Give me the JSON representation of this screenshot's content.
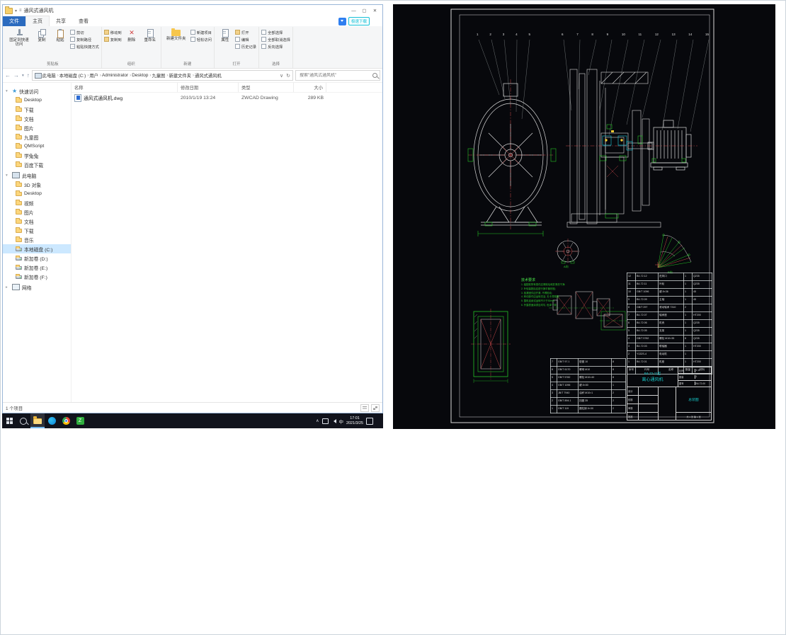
{
  "explorer": {
    "titlebar": {
      "title": "通风式通风机",
      "minimize": "—",
      "maximize": "▢",
      "close": "✕"
    },
    "tabs": {
      "file": "文件",
      "home": "主页",
      "share": "共享",
      "view": "查看"
    },
    "overlay": {
      "badge": "极速下载"
    },
    "ribbon": {
      "pin": "固定到快速访问",
      "copy": "复制",
      "paste": "粘贴",
      "cut": "剪切",
      "copy_path": "复制路径",
      "paste_shortcut": "粘贴快捷方式",
      "clipboard_label": "剪贴板",
      "move_to": "移动到",
      "copy_to": "复制到",
      "delete": "删除",
      "rename": "重命名",
      "organize_label": "组织",
      "new_folder": "新建文件夹",
      "new_item": "新建项目",
      "easy_access": "轻松访问",
      "new_label": "新建",
      "properties": "属性",
      "open": "打开",
      "edit": "编辑",
      "history": "历史记录",
      "open_label": "打开",
      "select_all": "全部选择",
      "select_none": "全部取消选择",
      "invert": "反向选择",
      "select_label": "选择"
    },
    "address": {
      "segments": [
        {
          "label": "此电脑"
        },
        {
          "label": "本地磁盘 (C:)"
        },
        {
          "label": "用户"
        },
        {
          "label": "Administrator"
        },
        {
          "label": "Desktop"
        },
        {
          "label": "九童图"
        },
        {
          "label": "新建文件夹"
        },
        {
          "label": "通风式通风机"
        }
      ],
      "search_placeholder": "搜索\"通风式通风机\""
    },
    "columns": {
      "name": "名称",
      "date": "修改日期",
      "type": "类型",
      "size": "大小"
    },
    "files": [
      {
        "name": "通风式通风机.dwg",
        "modified": "2010/1/19 13:24",
        "type": "ZWCAD Drawing",
        "size": "289 KB"
      }
    ],
    "sidebar": {
      "quick_access": {
        "label": "快速访问",
        "items": [
          {
            "label": "Desktop",
            "icon": "folder"
          },
          {
            "label": "下载",
            "icon": "folder"
          },
          {
            "label": "文档",
            "icon": "folder"
          },
          {
            "label": "图片",
            "icon": "folder"
          },
          {
            "label": "九童图",
            "icon": "folder"
          },
          {
            "label": "QMScript",
            "icon": "folder"
          },
          {
            "label": "学兔兔",
            "icon": "folder"
          },
          {
            "label": "百度下载",
            "icon": "folder"
          }
        ]
      },
      "this_pc": {
        "label": "此电脑",
        "items": [
          {
            "label": "3D 对象",
            "icon": "folder"
          },
          {
            "label": "Desktop",
            "icon": "folder"
          },
          {
            "label": "视频",
            "icon": "folder"
          },
          {
            "label": "图片",
            "icon": "folder"
          },
          {
            "label": "文档",
            "icon": "folder"
          },
          {
            "label": "下载",
            "icon": "folder"
          },
          {
            "label": "音乐",
            "icon": "folder"
          },
          {
            "label": "本地磁盘 (C:)",
            "icon": "drive",
            "selected": true
          },
          {
            "label": "新加卷 (D:)",
            "icon": "drive"
          },
          {
            "label": "新加卷 (E:)",
            "icon": "drive"
          },
          {
            "label": "新加卷 (F:)",
            "icon": "drive"
          }
        ]
      },
      "network": {
        "label": "网络"
      }
    },
    "status": "1 个项目"
  },
  "taskbar": {
    "ime": "中",
    "time": "17:01",
    "date": "2021/3/25"
  },
  "cad": {
    "leaders_a": [
      "1",
      "2",
      "3",
      "4",
      "5"
    ],
    "leaders_b": [
      "6",
      "7",
      "8",
      "9",
      "10",
      "11",
      "12",
      "13",
      "14",
      "15"
    ],
    "tech": {
      "title": "技术要求",
      "lines": [
        "1. 装配前所有零件应清除毛刺并清洗干净;",
        "2. 叶轮装配后应进行静平衡校验;",
        "3. 各紧固件应拧紧, 不得松动;",
        "4. 转动部件应运转灵活, 无卡滞现象;",
        "5. 整机连续试运转不少于30min;",
        "6. 外露表面涂漆应均匀, 色泽一致。"
      ]
    },
    "detail_a": "A向",
    "detail_b": "B向",
    "bom": {
      "header": [
        "序号",
        "代号",
        "名称",
        "数量",
        "材料"
      ],
      "rows": [
        [
          "12",
          "B4-72.12",
          "进风口",
          "1",
          "Q235"
        ],
        [
          "11",
          "B4-72.11",
          "叶轮",
          "1",
          "Q235"
        ],
        [
          "10",
          "GB/T 1096",
          "键 8×36",
          "1",
          "45"
        ],
        [
          "9",
          "B4-72.09",
          "主轴",
          "1",
          "45"
        ],
        [
          "8",
          "GB/T 297",
          "滚动轴承 7310",
          "2",
          ""
        ],
        [
          "7",
          "B4-72.07",
          "轴承座",
          "1",
          "HT200"
        ],
        [
          "6",
          "B4-72.06",
          "机壳",
          "1",
          "Q235"
        ],
        [
          "5",
          "B4-72.05",
          "支架",
          "1",
          "Q235"
        ],
        [
          "4",
          "GB/T 5782",
          "螺栓 M10×35",
          "8",
          "Q235"
        ],
        [
          "3",
          "B4-72.03",
          "联轴器",
          "1",
          "HT200"
        ],
        [
          "2",
          "Y132S-4",
          "电动机",
          "1",
          ""
        ],
        [
          "1",
          "B4-72.01",
          "机座",
          "1",
          "HT200"
        ]
      ]
    },
    "parts": {
      "rows": [
        [
          "7",
          "GB/T 97.1",
          "垫圈 10",
          "8"
        ],
        [
          "6",
          "GB/T 6170",
          "螺母 M10",
          "8"
        ],
        [
          "5",
          "GB/T 5782",
          "螺栓 M10×40",
          "8"
        ],
        [
          "4",
          "GB/T 1096",
          "键 8×50",
          "1"
        ],
        [
          "3",
          "JB/T 7940",
          "油杯 M10×1",
          "2"
        ],
        [
          "2",
          "GB/T 894.1",
          "挡圈 35",
          "2"
        ],
        [
          "1",
          "GB/T 119",
          "圆柱销 6×30",
          "2"
        ]
      ]
    },
    "title_block": {
      "model": "B4-72-11型",
      "name": "离心通风机",
      "drawing": "总装图",
      "scale_label": "比例",
      "scale": "1:10",
      "qty_label": "数量",
      "qty": "1",
      "no_label": "图号",
      "no": "B4-72-00",
      "design": "设计",
      "check": "校核",
      "review": "审核",
      "approve": "批准",
      "sheet": "共 1 张  第 1 张"
    }
  }
}
